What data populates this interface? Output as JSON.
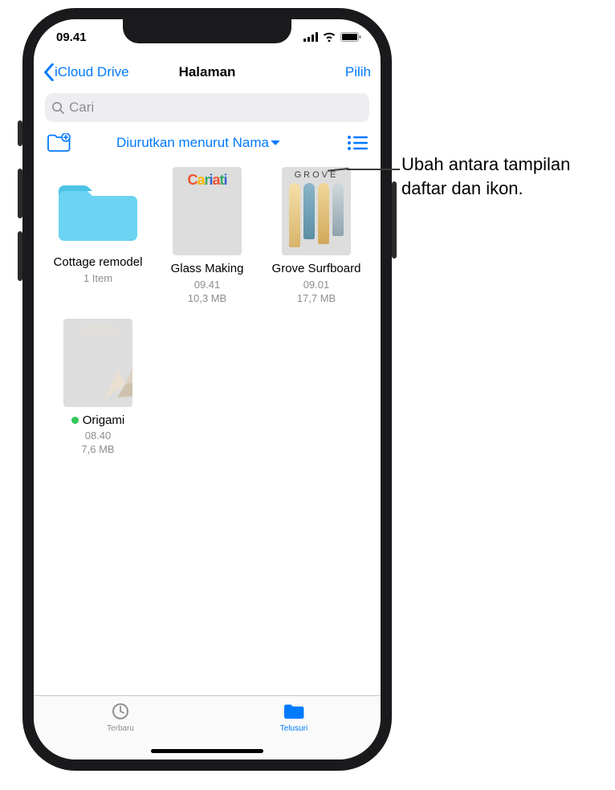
{
  "status": {
    "time": "09.41"
  },
  "nav": {
    "back": "iCloud Drive",
    "title": "Halaman",
    "action": "Pilih"
  },
  "search": {
    "placeholder": "Cari"
  },
  "toolbar": {
    "sort_label": "Diurutkan menurut Nama"
  },
  "items": [
    {
      "name": "Cottage remodel",
      "meta": "1 Item",
      "kind": "folder"
    },
    {
      "name": "Glass Making",
      "meta": "09.41\n10,3 MB",
      "kind": "doc",
      "thumb": "cariati"
    },
    {
      "name": "Grove Surfboard",
      "meta": "09.01\n17,7 MB",
      "kind": "doc",
      "thumb": "grove"
    },
    {
      "name": "Origami",
      "meta": "08.40\n7,6 MB",
      "kind": "doc",
      "thumb": "origami",
      "badge": "green-dot"
    }
  ],
  "tabs": {
    "recents": "Terbaru",
    "browse": "Telusuri"
  },
  "callout": "Ubah antara tampilan daftar dan ikon.",
  "decor": {
    "cariati": "Cariati",
    "grove": "GROVE",
    "origami": "ORIGAMI TREASURES"
  }
}
